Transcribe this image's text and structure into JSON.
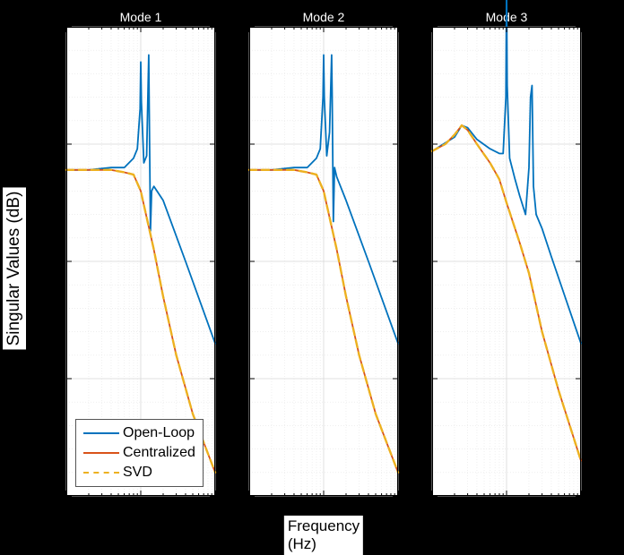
{
  "chart_data": [
    {
      "type": "line",
      "title": "Mode 1",
      "xlabel": "",
      "ylabel": "Singular Values (dB)",
      "xscale": "log",
      "xlim": [
        0.1,
        10
      ],
      "ylim": [
        -150,
        50
      ],
      "xticks": [
        "10^{-1}",
        "10^{0}",
        "10^{1}"
      ],
      "yticks": [
        -150,
        -100,
        -50,
        0,
        50
      ],
      "series": [
        {
          "name": "Open-Loop",
          "color": "#0072BD",
          "style": "solid",
          "x": [
            0.1,
            0.2,
            0.4,
            0.6,
            0.8,
            0.9,
            0.98,
            1.0,
            1.02,
            1.1,
            1.2,
            1.28,
            1.3,
            1.35,
            1.4,
            1.5,
            2.0,
            4.0,
            10.0
          ],
          "y": [
            -11,
            -11,
            -10,
            -10,
            -6,
            -2,
            15,
            35,
            18,
            -8,
            -5,
            38,
            15,
            -37,
            -20,
            -18,
            -24,
            -50,
            -85
          ]
        },
        {
          "name": "Centralized",
          "color": "#D95319",
          "style": "solid",
          "x": [
            0.1,
            0.2,
            0.4,
            0.6,
            0.8,
            1.0,
            1.5,
            2.0,
            3.0,
            5.0,
            10.0
          ],
          "y": [
            -11,
            -11,
            -11,
            -12,
            -13,
            -20,
            -45,
            -65,
            -90,
            -115,
            -140
          ]
        },
        {
          "name": "SVD",
          "color": "#EDB120",
          "style": "dash",
          "x": [
            0.1,
            0.2,
            0.4,
            0.6,
            0.8,
            1.0,
            1.5,
            2.0,
            3.0,
            5.0,
            10.0
          ],
          "y": [
            -11,
            -11,
            -11,
            -12,
            -13,
            -20,
            -45,
            -65,
            -90,
            -115,
            -140
          ]
        }
      ],
      "legend": {
        "position": "lower-left",
        "entries": [
          "Open-Loop",
          "Centralized",
          "SVD"
        ]
      }
    },
    {
      "type": "line",
      "title": "Mode 2",
      "xlabel": "Frequency (Hz)",
      "ylabel": "",
      "xscale": "log",
      "xlim": [
        0.1,
        10
      ],
      "ylim": [
        -150,
        50
      ],
      "xticks": [
        "10^{-1}",
        "10^{0}",
        "10^{1}"
      ],
      "series": [
        {
          "name": "Open-Loop",
          "color": "#0072BD",
          "style": "solid",
          "x": [
            0.1,
            0.2,
            0.4,
            0.6,
            0.8,
            0.9,
            0.98,
            1.0,
            1.02,
            1.1,
            1.2,
            1.28,
            1.3,
            1.35,
            1.4,
            1.5,
            2.0,
            4.0,
            10.0
          ],
          "y": [
            -11,
            -11,
            -10,
            -10,
            -6,
            -2,
            20,
            38,
            20,
            -5,
            5,
            38,
            22,
            -33,
            -10,
            -14,
            -24,
            -50,
            -85
          ]
        },
        {
          "name": "Centralized",
          "color": "#D95319",
          "style": "solid",
          "x": [
            0.1,
            0.2,
            0.4,
            0.6,
            0.8,
            1.0,
            1.5,
            2.0,
            3.0,
            5.0,
            10.0
          ],
          "y": [
            -11,
            -11,
            -11,
            -12,
            -13,
            -20,
            -45,
            -65,
            -90,
            -115,
            -140
          ]
        },
        {
          "name": "SVD",
          "color": "#EDB120",
          "style": "dash",
          "x": [
            0.1,
            0.2,
            0.4,
            0.6,
            0.8,
            1.0,
            1.5,
            2.0,
            3.0,
            5.0,
            10.0
          ],
          "y": [
            -11,
            -11,
            -11,
            -12,
            -13,
            -20,
            -45,
            -65,
            -90,
            -115,
            -140
          ]
        }
      ]
    },
    {
      "type": "line",
      "title": "Mode 3",
      "xlabel": "",
      "ylabel": "",
      "xscale": "log",
      "xlim": [
        0.1,
        10
      ],
      "ylim": [
        -150,
        50
      ],
      "xticks": [
        "10^{-1}",
        "10^{0}",
        "10^{1}"
      ],
      "series": [
        {
          "name": "Open-Loop",
          "color": "#0072BD",
          "style": "solid",
          "x": [
            0.1,
            0.2,
            0.25,
            0.3,
            0.4,
            0.6,
            0.8,
            0.9,
            0.98,
            1.0,
            1.02,
            1.1,
            1.3,
            1.5,
            1.8,
            2.0,
            2.1,
            2.2,
            2.3,
            2.5,
            3.0,
            4.0,
            10.0
          ],
          "y": [
            -3,
            3,
            8,
            7,
            2,
            -2,
            -4,
            -4,
            20,
            70,
            25,
            -6,
            -15,
            -22,
            -30,
            -10,
            20,
            25,
            -18,
            -30,
            -36,
            -48,
            -85
          ]
        },
        {
          "name": "Centralized",
          "color": "#D95319",
          "style": "solid",
          "x": [
            0.1,
            0.15,
            0.2,
            0.25,
            0.3,
            0.4,
            0.6,
            0.8,
            1.0,
            1.5,
            2.0,
            3.0,
            5.0,
            10.0
          ],
          "y": [
            -3,
            0,
            4,
            8,
            6,
            0,
            -8,
            -15,
            -25,
            -42,
            -55,
            -80,
            -105,
            -135
          ]
        },
        {
          "name": "SVD",
          "color": "#EDB120",
          "style": "dash",
          "x": [
            0.1,
            0.15,
            0.2,
            0.25,
            0.3,
            0.4,
            0.6,
            0.8,
            1.0,
            1.5,
            2.0,
            3.0,
            5.0,
            10.0
          ],
          "y": [
            -3,
            0,
            4,
            8,
            6,
            0,
            -8,
            -15,
            -25,
            -42,
            -55,
            -80,
            -105,
            -135
          ]
        }
      ]
    }
  ],
  "shared": {
    "ylabel": "Singular Values (dB)",
    "xlabel_center": "Frequency (Hz)"
  },
  "legend_labels": {
    "open_loop": "Open-Loop",
    "centralized": "Centralized",
    "svd": "SVD"
  }
}
